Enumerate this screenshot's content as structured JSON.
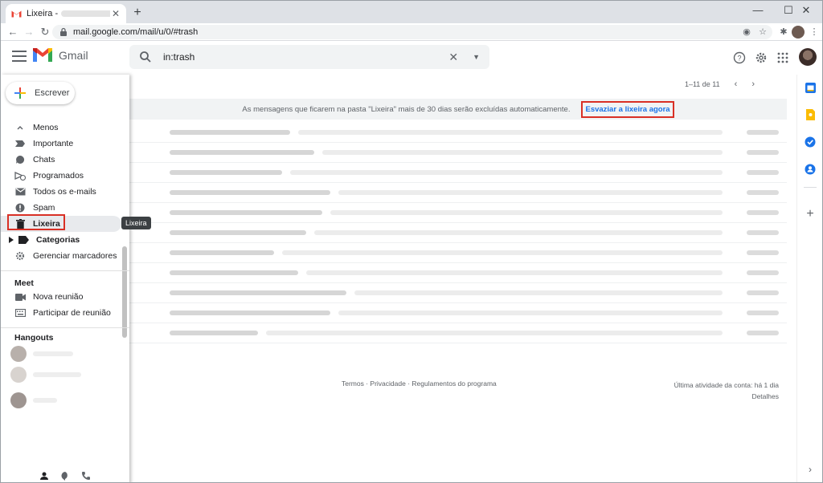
{
  "browser": {
    "tab_title": "Lixeira -",
    "tab_close": "✕",
    "new_tab": "+",
    "url": "mail.google.com/mail/u/0/#trash",
    "window_controls": {
      "minimize": "—",
      "maximize": "☐",
      "close": "✕"
    }
  },
  "header": {
    "product_name": "Gmail",
    "search_query": "in:trash"
  },
  "sidebar": {
    "compose_label": "Escrever",
    "nav_items": [
      {
        "label": "Menos",
        "icon": "chevron-up-icon"
      },
      {
        "label": "Importante",
        "icon": "important-icon"
      },
      {
        "label": "Chats",
        "icon": "chat-icon"
      },
      {
        "label": "Programados",
        "icon": "scheduled-icon"
      },
      {
        "label": "Todos os e-mails",
        "icon": "all-mail-icon"
      },
      {
        "label": "Spam",
        "icon": "spam-icon"
      },
      {
        "label": "Lixeira",
        "icon": "trash-icon",
        "active": true
      },
      {
        "label": "Categorias",
        "icon": "expand-arrow-icon",
        "bold": true
      },
      {
        "label": "Gerenciar marcadores",
        "icon": "gear-icon"
      }
    ],
    "tooltip": "Lixeira",
    "meet": {
      "title": "Meet",
      "items": [
        {
          "label": "Nova reunião",
          "icon": "video-camera-icon"
        },
        {
          "label": "Participar de reunião",
          "icon": "keyboard-icon"
        }
      ]
    },
    "hangouts_title": "Hangouts"
  },
  "main": {
    "pagination": "1–11 de 11",
    "banner_text": "As mensagens que ficarem na pasta \"Lixeira\" mais de 30 dias serão excluídas automaticamente.",
    "banner_link": "Esvaziar a lixeira agora",
    "footer_links": "Termos · Privacidade · Regulamentos do programa",
    "last_activity": "Última atividade da conta: há 1 dia",
    "details": "Detalhes"
  },
  "colors": {
    "accent": "#1a73e8",
    "highlight": "#d93025"
  }
}
